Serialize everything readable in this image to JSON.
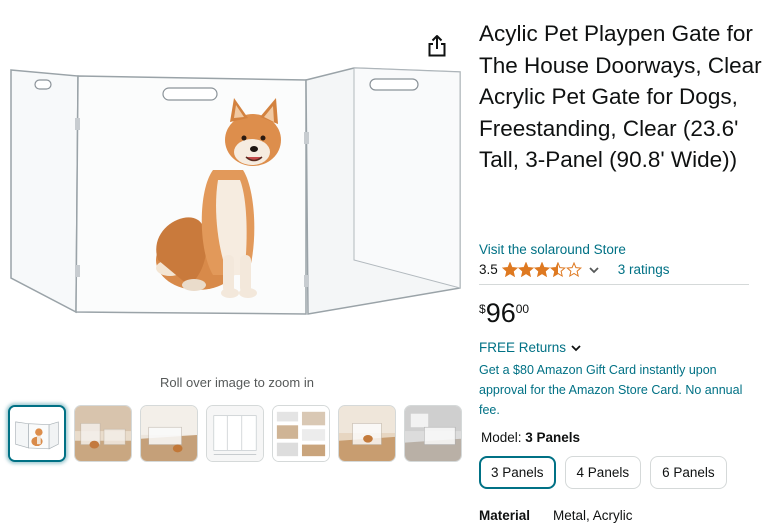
{
  "product": {
    "title": "Acylic Pet Playpen Gate for The House Doorways, Clear Acrylic Pet Gate for Dogs, Freestanding, Clear (23.6' Tall, 3-Panel (90.8' Wide))",
    "store_link": "Visit the solaround Store",
    "rating": {
      "value": "3.5",
      "stars": 3.5,
      "max_stars": 5,
      "star_color": "#de7921",
      "ratings_link": "3 ratings"
    },
    "price": {
      "symbol": "$",
      "whole": "96",
      "fraction": "00"
    },
    "free_returns": "FREE Returns",
    "gift_card_offer": "Get a $80 Amazon Gift Card instantly upon approval for the Amazon Store Card. No annual fee.",
    "model": {
      "label": "Model:",
      "value": "3 Panels",
      "options": [
        "3 Panels",
        "4 Panels",
        "6 Panels"
      ],
      "selected_index": 0
    },
    "material": {
      "label": "Material",
      "value": "Metal, Acrylic"
    }
  },
  "gallery": {
    "zoom_hint": "Roll over image to zoom in",
    "thumbnail_count": 7,
    "selected_thumbnail": 0
  },
  "icons": {
    "share": "share-icon",
    "chevron": "chevron-down-icon",
    "star": "star-icon"
  },
  "colors": {
    "link": "#007185",
    "text": "#0f1111",
    "muted": "#565959",
    "border": "#d5d9d9",
    "selected_border": "#007185"
  }
}
